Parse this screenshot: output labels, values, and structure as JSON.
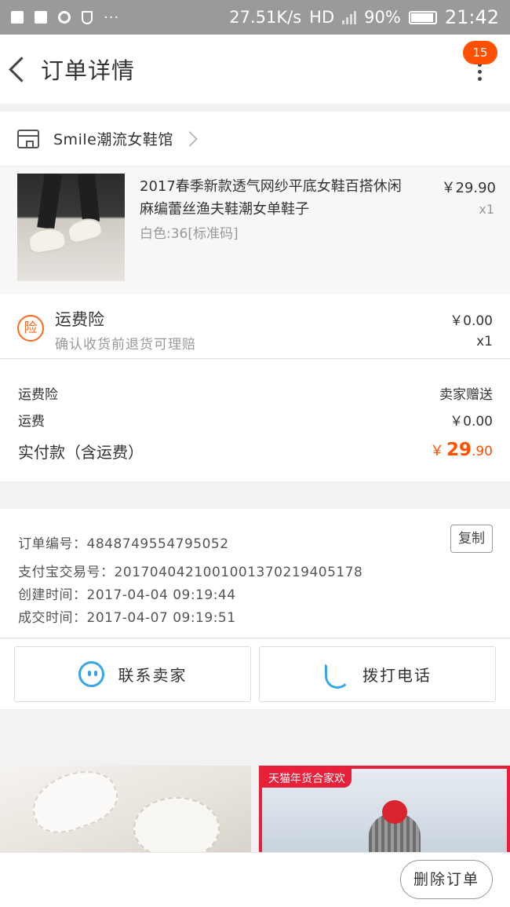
{
  "status_bar": {
    "network_speed": "27.51K/s",
    "network_type": "HD",
    "battery": "90%",
    "time": "21:42"
  },
  "nav": {
    "title": "订单详情",
    "badge_count": "15"
  },
  "shop": {
    "name": "Smile潮流女鞋馆"
  },
  "product": {
    "title": "2017春季新款透气网纱平底女鞋百搭休闲麻编蕾丝渔夫鞋潮女单鞋子",
    "sku": "白色:36[标准码]",
    "price": "￥29.90",
    "qty": "x1"
  },
  "insurance": {
    "icon_label": "险",
    "title": "运费险",
    "desc": "确认收货前退货可理赔",
    "price": "￥0.00",
    "qty": "x1"
  },
  "summary": {
    "insurance_label": "运费险",
    "insurance_value": "卖家赠送",
    "shipping_label": "运费",
    "shipping_value": "￥0.00",
    "total_label": "实付款（含运费）",
    "total_currency": "￥",
    "total_int": "29",
    "total_dec": ".90"
  },
  "order_info": {
    "order_no": "订单编号：4848749554795052",
    "alipay_no": "支付宝交易号：2017040421001001370219405178",
    "created": "创建时间：2017-04-04 09:19:44",
    "completed": "成交时间：2017-04-07 09:19:51",
    "copy_label": "复制"
  },
  "actions": {
    "contact_seller": "联系卖家",
    "call_phone": "拨打电话",
    "delete_order": "删除订单"
  },
  "recommend": {
    "promo_label": "天猫年货合家欢"
  },
  "colors": {
    "accent": "#ff5000",
    "icon_blue": "#36a7e6"
  }
}
